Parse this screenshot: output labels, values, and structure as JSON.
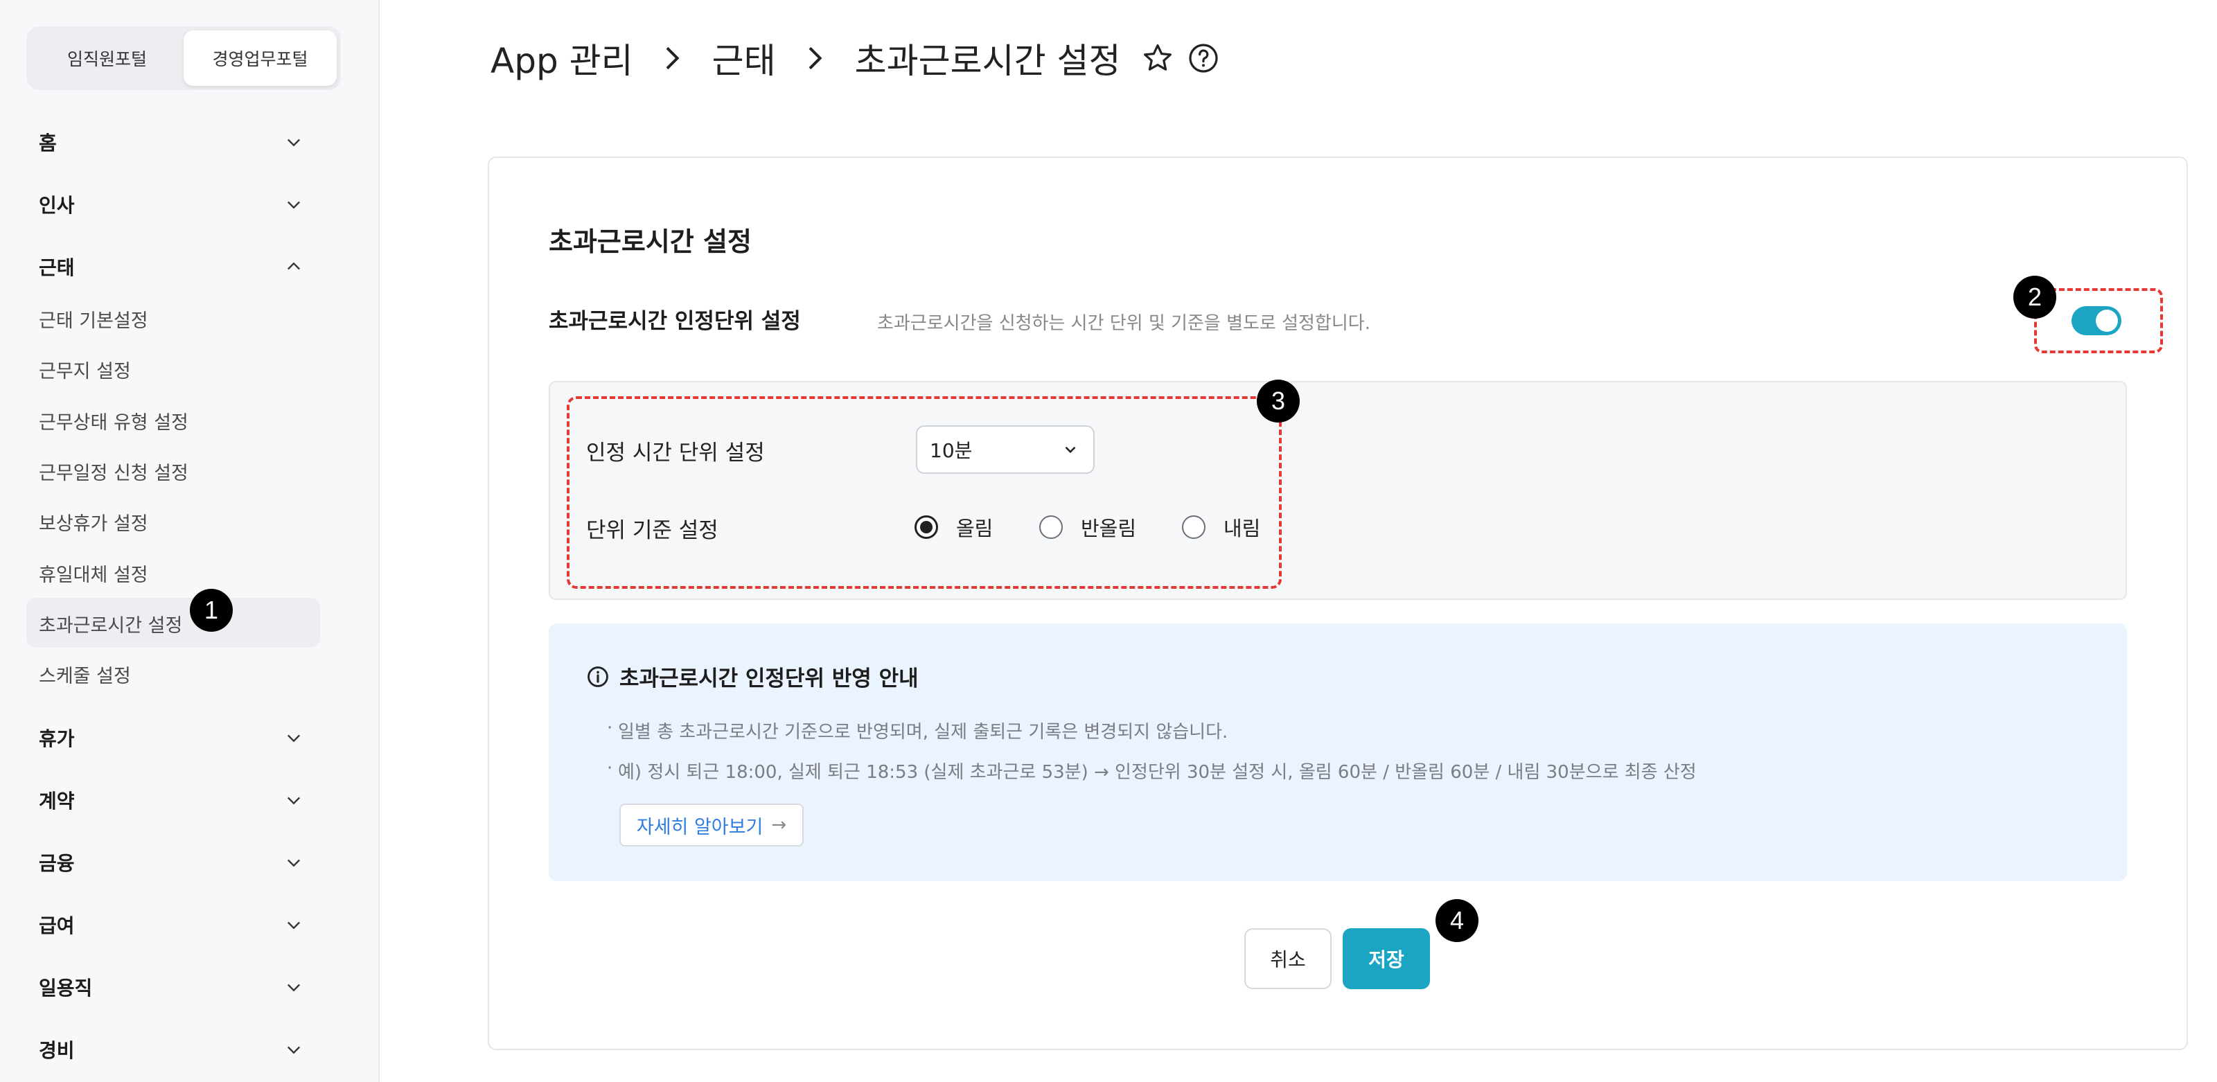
{
  "portal_tabs": [
    {
      "label": "임직원포털",
      "active": false
    },
    {
      "label": "경영업무포털",
      "active": true
    }
  ],
  "nav": {
    "groups_top": [
      {
        "label": "홈",
        "expanded": false
      },
      {
        "label": "인사",
        "expanded": false
      },
      {
        "label": "근태",
        "expanded": true
      }
    ],
    "sub_items": [
      {
        "label": "근태 기본설정"
      },
      {
        "label": "근무지 설정"
      },
      {
        "label": "근무상태 유형 설정"
      },
      {
        "label": "근무일정 신청 설정"
      },
      {
        "label": "보상휴가 설정"
      },
      {
        "label": "휴일대체 설정"
      },
      {
        "label": "초과근로시간 설정",
        "active": true
      },
      {
        "label": "스케줄 설정"
      }
    ],
    "groups_bottom": [
      {
        "label": "휴가"
      },
      {
        "label": "계약"
      },
      {
        "label": "금융"
      },
      {
        "label": "급여"
      },
      {
        "label": "일용직"
      },
      {
        "label": "경비"
      }
    ]
  },
  "breadcrumb": [
    "App 관리",
    "근태",
    "초과근로시간 설정"
  ],
  "header_icons": [
    "star-icon",
    "help-icon"
  ],
  "card": {
    "title": "초과근로시간 설정",
    "row_label": "초과근로시간 인정단위 설정",
    "row_desc": "초과근로시간을 신청하는 시간 단위 및 기준을 별도로 설정합니다.",
    "toggle_on": true,
    "settings": {
      "unit_label": "인정 시간 단위 설정",
      "unit_value": "10분",
      "basis_label": "단위 기준 설정",
      "basis_options": [
        {
          "label": "올림",
          "checked": true
        },
        {
          "label": "반올림",
          "checked": false
        },
        {
          "label": "내림",
          "checked": false
        }
      ]
    },
    "info": {
      "title": "초과근로시간 인정단위 반영 안내",
      "lines": [
        "일별 총 초과근로시간 기준으로 반영되며, 실제 출퇴근 기록은 변경되지 않습니다.",
        "예) 정시 퇴근 18:00, 실제 퇴근 18:53 (실제 초과근로 53분) → 인정단위 30분 설정 시, 올림 60분 / 반올림 60분 / 내림 30분으로 최종 산정"
      ],
      "learn_more": "자세히 알아보기",
      "learn_more_arrow": "→"
    },
    "buttons": {
      "cancel": "취소",
      "save": "저장"
    }
  },
  "annotations": [
    "1",
    "2",
    "3",
    "4"
  ],
  "colors": {
    "accent": "#1ba5c3",
    "annotation_border": "#e53935",
    "info_bg": "#ebf3fe",
    "link": "#2f7de1"
  }
}
